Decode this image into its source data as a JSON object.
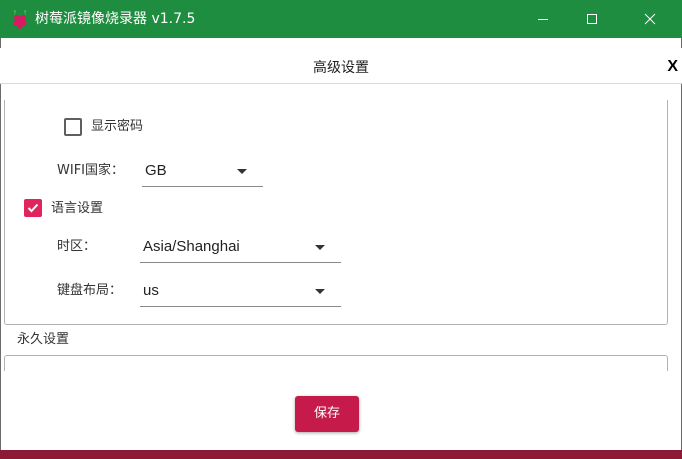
{
  "window": {
    "title": "树莓派镜像烧录器 v1.7.5",
    "logo_icon": "raspberry-pi-logo",
    "controls": [
      "minimize-icon",
      "maximize-icon",
      "close-icon"
    ],
    "titlebar_color": "#1f8d3f"
  },
  "dialog": {
    "title": "高级设置",
    "close_label": "X"
  },
  "settings": {
    "show_password": {
      "label": "显示密码",
      "checked": false
    },
    "wifi_country": {
      "label": "WIFI国家：",
      "value": "GB"
    },
    "locale": {
      "label": "语言设置",
      "checked": true,
      "timezone": {
        "label": "时区：",
        "value": "Asia/Shanghai"
      },
      "keyboard": {
        "label": "键盘布局：",
        "value": "us"
      }
    }
  },
  "permanent": {
    "label": "永久设置"
  },
  "actions": {
    "save_label": "保存"
  },
  "colors": {
    "accent": "#c51a4a",
    "checkbox_checked": "#e0245e",
    "bottom_bar": "#8c1a36"
  }
}
